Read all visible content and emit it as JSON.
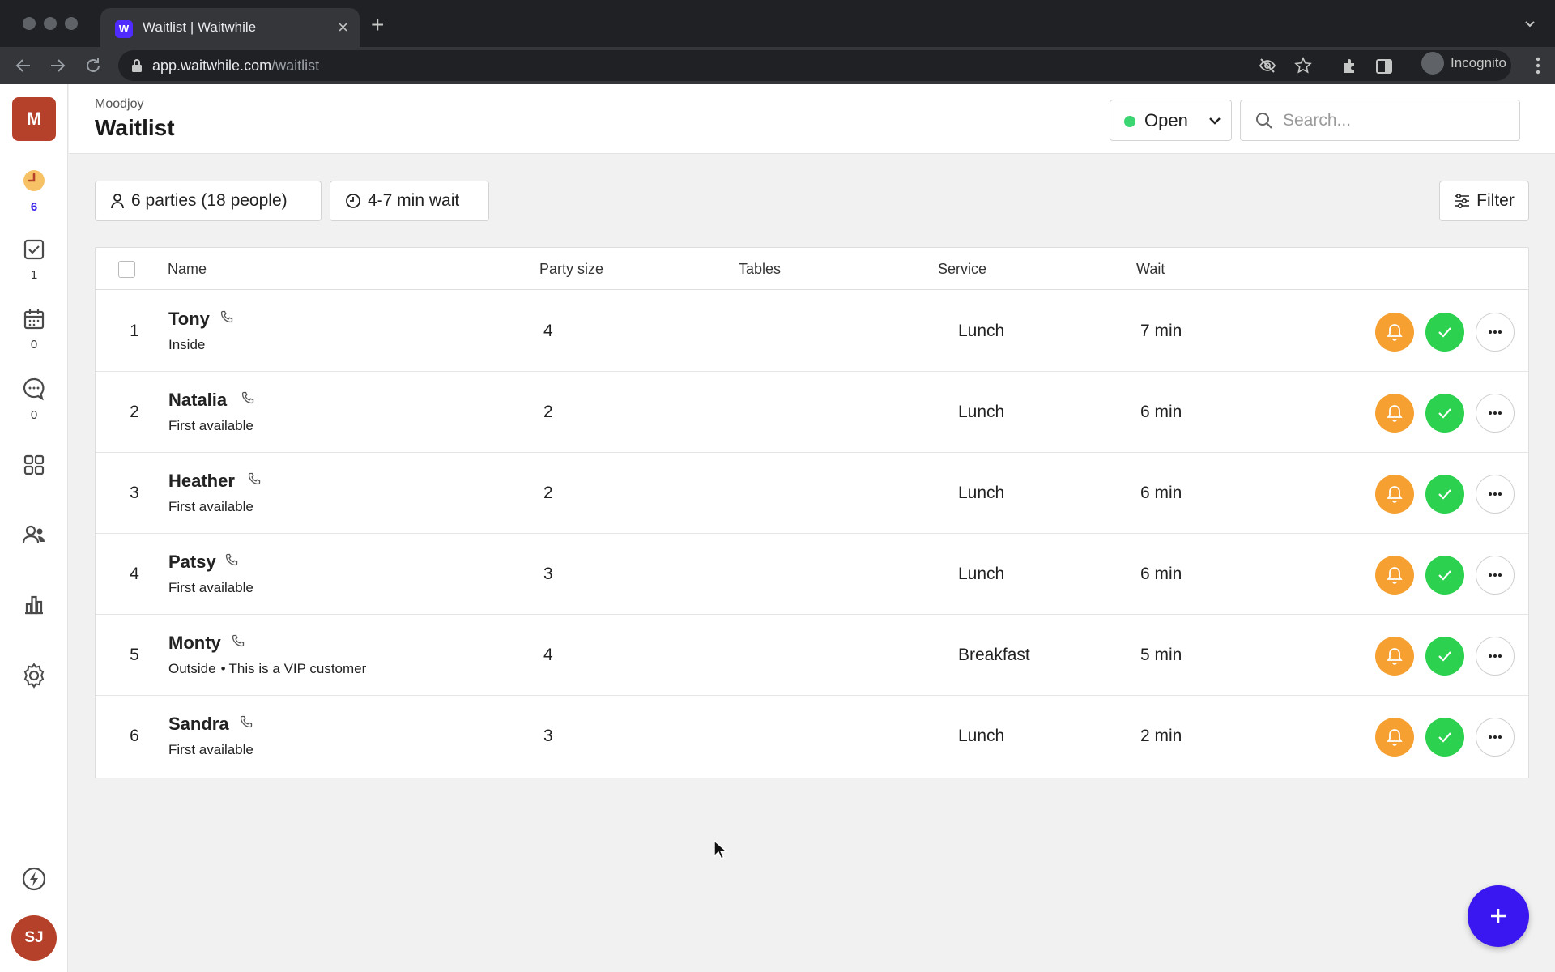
{
  "browser": {
    "tab_title": "Waitlist | Waitwhile",
    "favicon_letter": "W",
    "new_tab": "+",
    "close_tab": "×",
    "url_host": "app.waitwhile.com",
    "url_path": "/waitlist",
    "incognito_label": "Incognito"
  },
  "sidebar": {
    "org_initial": "M",
    "items": [
      {
        "icon": "clock-icon",
        "count": "6",
        "active": true
      },
      {
        "icon": "checkbox-icon",
        "count": "1"
      },
      {
        "icon": "calendar-icon",
        "count": "0"
      },
      {
        "icon": "chat-icon",
        "count": "0"
      },
      {
        "icon": "apps-grid-icon"
      },
      {
        "icon": "users-icon"
      },
      {
        "icon": "analytics-icon"
      },
      {
        "icon": "settings-gear-icon"
      }
    ],
    "bottom_icon": "lightning-icon",
    "user_initials": "SJ"
  },
  "header": {
    "org_name": "Moodjoy",
    "title": "Waitlist",
    "status_label": "Open",
    "status_color": "#3bd671",
    "search_placeholder": "Search..."
  },
  "summary": {
    "parties": "6 parties (18 people)",
    "wait": "4-7 min wait",
    "filter_label": "Filter"
  },
  "table": {
    "columns": {
      "name": "Name",
      "party_size": "Party size",
      "tables": "Tables",
      "service": "Service",
      "wait": "Wait"
    },
    "rows": [
      {
        "num": "1",
        "name": "Tony",
        "sub": "Inside",
        "note": "",
        "party_size": "4",
        "service": "Lunch",
        "wait": "7 min"
      },
      {
        "num": "2",
        "name": "Natalia",
        "sub": "First available",
        "note": "",
        "party_size": "2",
        "service": "Lunch",
        "wait": "6 min"
      },
      {
        "num": "3",
        "name": "Heather",
        "sub": "First available",
        "note": "",
        "party_size": "2",
        "service": "Lunch",
        "wait": "6 min"
      },
      {
        "num": "4",
        "name": "Patsy",
        "sub": "First available",
        "note": "",
        "party_size": "3",
        "service": "Lunch",
        "wait": "6 min"
      },
      {
        "num": "5",
        "name": "Monty",
        "sub": "Outside",
        "note": "This is a VIP customer",
        "party_size": "4",
        "service": "Breakfast",
        "wait": "5 min"
      },
      {
        "num": "6",
        "name": "Sandra",
        "sub": "First available",
        "note": "",
        "party_size": "3",
        "service": "Lunch",
        "wait": "2 min"
      }
    ]
  },
  "colors": {
    "accent": "#3a17f0",
    "notify": "#f5a030",
    "serve": "#2bd14f",
    "org_avatar": "#b5412a"
  }
}
